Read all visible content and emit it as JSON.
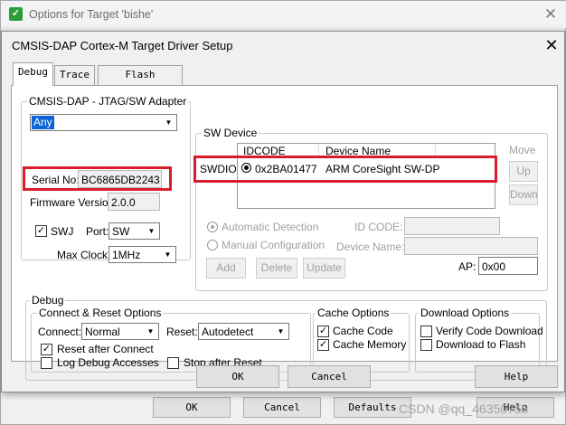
{
  "parent_window": {
    "title": "Options for Target 'bishe'",
    "icon": "keil-icon",
    "buttons": {
      "ok": "OK",
      "cancel": "Cancel",
      "defaults": "Defaults",
      "help": "Help"
    }
  },
  "dialog": {
    "title": "CMSIS-DAP Cortex-M Target Driver Setup",
    "tabs": [
      {
        "label": "Debug",
        "active": true
      },
      {
        "label": "Trace",
        "active": false
      },
      {
        "label": "Flash Download",
        "active": false
      }
    ]
  },
  "adapter": {
    "group_label": "CMSIS-DAP - JTAG/SW Adapter",
    "selected": "Any",
    "serial_label": "Serial No:",
    "serial_value": "BC6865DB2243",
    "firmware_label": "Firmware Version:",
    "firmware_value": "2.0.0",
    "swj_label": "SWJ",
    "swj_checked": true,
    "port_label": "Port:",
    "port_value": "SW",
    "clock_label": "Max Clock:",
    "clock_value": "1MHz"
  },
  "sw_device": {
    "group_label": "SW Device",
    "columns": [
      "IDCODE",
      "Device Name"
    ],
    "row_label": "SWDIO",
    "rows": [
      {
        "idcode": "0x2BA01477",
        "device_name": "ARM CoreSight SW-DP"
      }
    ],
    "move_label": "Move",
    "up_label": "Up",
    "down_label": "Down",
    "auto_detect_label": "Automatic Detection",
    "manual_config_label": "Manual Configuration",
    "id_code_label": "ID CODE:",
    "device_name_label": "Device Name:",
    "add_label": "Add",
    "delete_label": "Delete",
    "update_label": "Update",
    "ap_label": "AP:",
    "ap_value": "0x00"
  },
  "debug": {
    "group_label": "Debug",
    "connect_reset": {
      "group_label": "Connect & Reset Options",
      "connect_label": "Connect:",
      "connect_value": "Normal",
      "reset_label": "Reset:",
      "reset_value": "Autodetect",
      "reset_after_connect_label": "Reset after Connect",
      "reset_after_connect_checked": true,
      "log_debug_label": "Log Debug Accesses",
      "log_debug_checked": false,
      "stop_after_reset_label": "Stop after Reset",
      "stop_after_reset_checked": false
    },
    "cache": {
      "group_label": "Cache Options",
      "cache_code_label": "Cache Code",
      "cache_code_checked": true,
      "cache_memory_label": "Cache Memory",
      "cache_memory_checked": true
    },
    "download": {
      "group_label": "Download Options",
      "verify_label": "Verify Code Download",
      "verify_checked": false,
      "flash_label": "Download to Flash",
      "flash_checked": false
    }
  },
  "dialog_buttons": {
    "ok": "OK",
    "cancel": "Cancel",
    "help": "Help"
  },
  "watermark": "CSDN @qq_46350758",
  "colors": {
    "highlight": "#d91c2a",
    "selection": "#0a64d6",
    "keil_green": "#2c9c3c"
  }
}
